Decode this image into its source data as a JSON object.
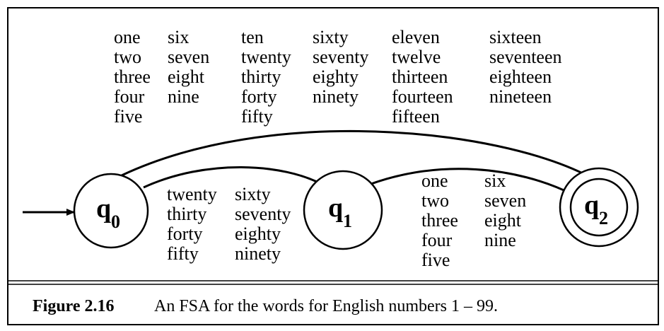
{
  "states": {
    "q0": {
      "label": "q",
      "sub": "0"
    },
    "q1": {
      "label": "q",
      "sub": "1"
    },
    "q2": {
      "label": "q",
      "sub": "2"
    }
  },
  "edge_q0_q2_words": [
    [
      "one",
      "two",
      "three",
      "four",
      "five"
    ],
    [
      "six",
      "seven",
      "eight",
      "nine"
    ],
    [
      "ten",
      "twenty",
      "thirty",
      "forty",
      "fifty"
    ],
    [
      "sixty",
      "seventy",
      "eighty",
      "ninety"
    ],
    [
      "eleven",
      "twelve",
      "thirteen",
      "fourteen",
      "fifteen"
    ],
    [
      "sixteen",
      "seventeen",
      "eighteen",
      "nineteen"
    ]
  ],
  "edge_q0_q1_words": [
    [
      "twenty",
      "thirty",
      "forty",
      "fifty"
    ],
    [
      "sixty",
      "seventy",
      "eighty",
      "ninety"
    ]
  ],
  "edge_q1_q2_words": [
    [
      "one",
      "two",
      "three",
      "four",
      "five"
    ],
    [
      "six",
      "seven",
      "eight",
      "nine"
    ]
  ],
  "caption": {
    "label": "Figure 2.16",
    "text": "An FSA for the words for English numbers 1 – 99."
  }
}
